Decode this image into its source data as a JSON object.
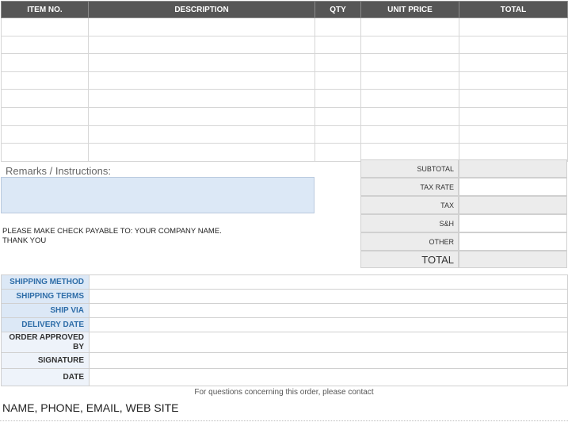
{
  "items_table": {
    "headers": [
      "ITEM NO.",
      "DESCRIPTION",
      "QTY",
      "UNIT PRICE",
      "TOTAL"
    ],
    "row_count": 8
  },
  "remarks": {
    "label": "Remarks / Instructions:",
    "value": ""
  },
  "payable": {
    "line1": "PLEASE MAKE CHECK PAYABLE TO: YOUR COMPANY NAME.",
    "line2": "THANK YOU"
  },
  "totals": {
    "subtotal": "SUBTOTAL",
    "tax_rate": "TAX RATE",
    "tax": "TAX",
    "sh": "S&H",
    "other": "OTHER",
    "total": "TOTAL"
  },
  "shipping": {
    "method": "SHIPPING METHOD",
    "terms": "SHIPPING TERMS",
    "via": "SHIP VIA",
    "delivery": "DELIVERY DATE",
    "approved": "ORDER APPROVED BY",
    "signature": "SIGNATURE",
    "date": "DATE"
  },
  "footer": {
    "note": "For questions concerning this order, please contact",
    "contact": "NAME, PHONE, EMAIL, WEB SITE"
  },
  "colors": {
    "header_bg": "#565656",
    "label_blue": "#2e6da8",
    "remarks_fill": "#dce8f6",
    "totals_fill": "#ececec"
  }
}
